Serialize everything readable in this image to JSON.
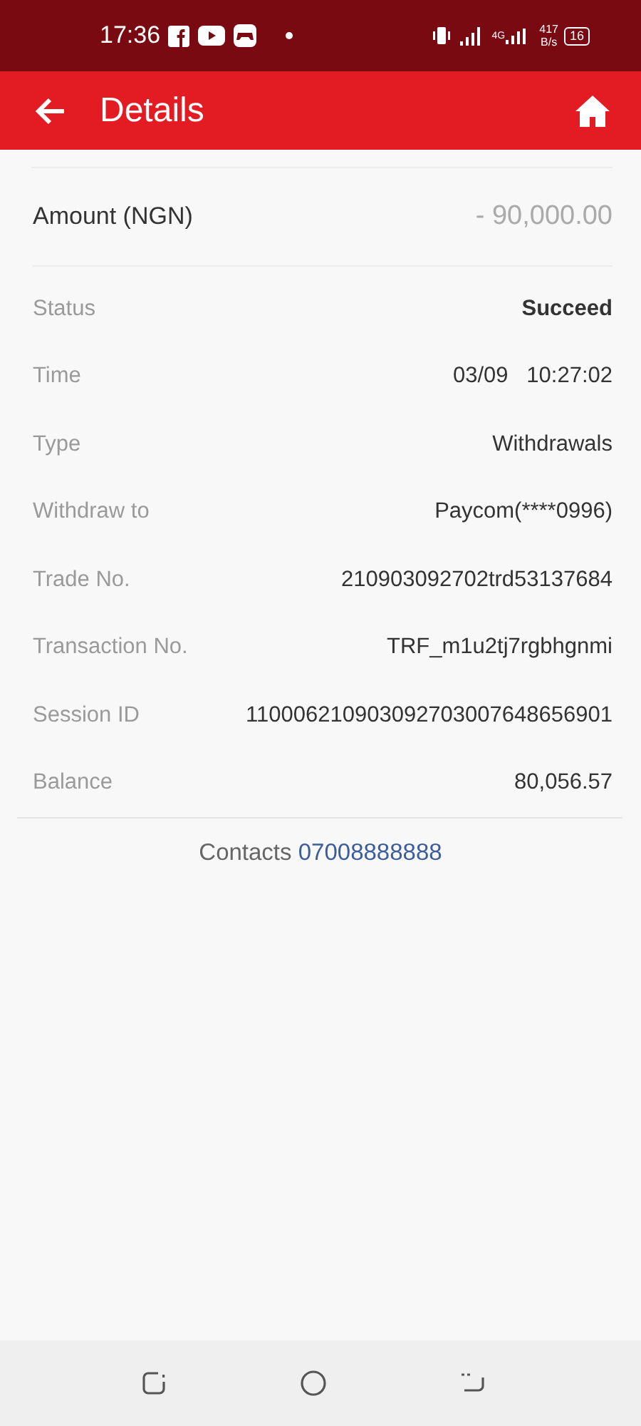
{
  "status_bar": {
    "time": "17:36",
    "network": "4G",
    "speed": "417",
    "speed_unit": "B/s",
    "battery": "16"
  },
  "header": {
    "title": "Details"
  },
  "amount": {
    "label": "Amount (NGN)",
    "value": "- 90,000.00"
  },
  "details": [
    {
      "label": "Status",
      "value": "Succeed",
      "bold": true
    },
    {
      "label": "Time",
      "value": "03/09   10:27:02",
      "bold": false
    },
    {
      "label": "Type",
      "value": "Withdrawals",
      "bold": false
    },
    {
      "label": "Withdraw to",
      "value": "Paycom(****0996)",
      "bold": false
    },
    {
      "label": "Trade No.",
      "value": "210903092702trd53137684",
      "bold": false
    },
    {
      "label": "Transaction No.",
      "value": "TRF_m1u2tj7rgbhgnmi",
      "bold": false
    },
    {
      "label": "Session ID",
      "value": "110006210903092703007648656901",
      "bold": false
    },
    {
      "label": "Balance",
      "value": "80,056.57",
      "bold": false
    }
  ],
  "contacts": {
    "label": "Contacts",
    "phone": "07008888888"
  }
}
